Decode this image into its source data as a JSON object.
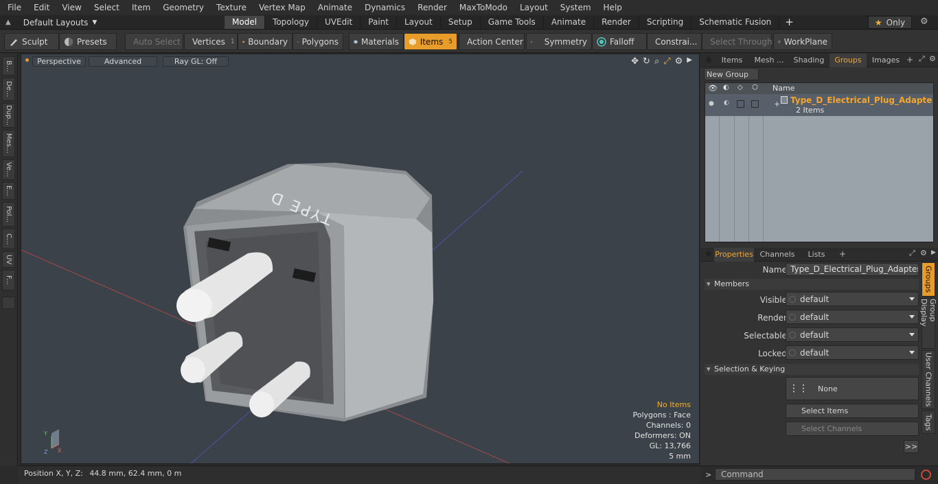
{
  "menu": [
    "File",
    "Edit",
    "View",
    "Select",
    "Item",
    "Geometry",
    "Texture",
    "Vertex Map",
    "Animate",
    "Dynamics",
    "Render",
    "MaxToModo",
    "Layout",
    "System",
    "Help"
  ],
  "layout_selector": "Default Layouts",
  "tabs": [
    {
      "label": "Model",
      "active": true
    },
    {
      "label": "Topology"
    },
    {
      "label": "UVEdit"
    },
    {
      "label": "Paint"
    },
    {
      "label": "Layout"
    },
    {
      "label": "Setup"
    },
    {
      "label": "Game Tools"
    },
    {
      "label": "Animate"
    },
    {
      "label": "Render"
    },
    {
      "label": "Scripting"
    },
    {
      "label": "Schematic Fusion"
    }
  ],
  "tabs_add": "+",
  "only_button": "Only",
  "toolbar": {
    "sculpt": "Sculpt",
    "presets": "Presets",
    "auto_select": "Auto Select",
    "vertices": "Vertices",
    "vertices_count": "1",
    "boundary": "Boundary",
    "polygons": "Polygons",
    "materials": "Materials",
    "items": "Items",
    "items_count": "5",
    "action_center": "Action Center",
    "symmetry": "Symmetry",
    "falloff": "Falloff",
    "constraints": "Constrai...",
    "select_through": "Select Through",
    "workplane": "WorkPlane"
  },
  "left_tabs": [
    "B...",
    "De...",
    "Dup...",
    "Mes...",
    "Ve...",
    "E...",
    "Pol...",
    "C...",
    "UV",
    "F..."
  ],
  "viewport": {
    "view_mode": "Perspective",
    "shading": "Advanced",
    "raygl": "Ray GL: Off",
    "model_text": "TYPE D",
    "stats": {
      "items": "No Items",
      "polygons": "Polygons : Face",
      "channels": "Channels: 0",
      "deformers": "Deformers: ON",
      "gl": "GL: 13,766",
      "grid": "5 mm"
    }
  },
  "status": {
    "label": "Position X, Y, Z:",
    "value": "44.8 mm, 62.4 mm, 0 m"
  },
  "scene_tabs": [
    {
      "label": "Items"
    },
    {
      "label": "Mesh ..."
    },
    {
      "label": "Shading"
    },
    {
      "label": "Groups",
      "active": true
    },
    {
      "label": "Images"
    }
  ],
  "new_group": "New Group",
  "groups_list": {
    "column_name": "Name",
    "row_title": "Type_D_Electrical_Plug_Adapte ...",
    "row_sub": "2 Items"
  },
  "props_tabs": [
    {
      "label": "Properties",
      "active": true
    },
    {
      "label": "Channels"
    },
    {
      "label": "Lists"
    }
  ],
  "props": {
    "name_label": "Name",
    "name_value": "Type_D_Electrical_Plug_Adapter_Black",
    "members": "Members",
    "visible_label": "Visible",
    "visible_value": "default",
    "render_label": "Render",
    "render_value": "default",
    "selectable_label": "Selectable",
    "selectable_value": "default",
    "locked_label": "Locked",
    "locked_value": "default",
    "selection_keying": "Selection & Keying",
    "none_label": "None",
    "select_items": "Select Items",
    "select_channels": "Select Channels",
    "more": ">>"
  },
  "side_tabs": [
    "Groups",
    "Group Display",
    "User Channels",
    "Tags"
  ],
  "command": {
    "prompt": ">",
    "placeholder": "Command"
  },
  "colors": {
    "accent": "#e89c2a",
    "viewport_bg": "#3b4249",
    "group_title": "#f2a630"
  }
}
